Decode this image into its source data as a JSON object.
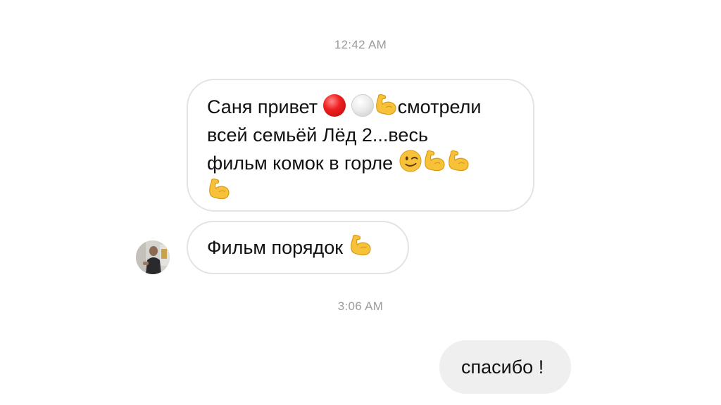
{
  "conversation": {
    "timestamps": [
      "12:42 AM",
      "3:06 AM"
    ],
    "messages": [
      {
        "direction": "incoming",
        "lines": [
          {
            "text_before": "Саня привет ",
            "text_after": "смотрели"
          },
          {
            "text": "всей семьёй Лёд 2...весь"
          },
          {
            "text": "фильм комок в горле "
          }
        ],
        "emoji_icons": [
          "red-circle-icon",
          "white-circle-icon",
          "flexed-biceps-icon",
          "winking-face-icon",
          "flexed-biceps-icon",
          "flexed-biceps-icon",
          "flexed-biceps-icon"
        ]
      },
      {
        "direction": "incoming",
        "text": "Фильм порядок ",
        "emoji_icons": [
          "flexed-biceps-icon"
        ]
      },
      {
        "direction": "outgoing",
        "text": "спасибо !"
      }
    ]
  },
  "colors": {
    "timestamp": "#9b9b9b",
    "incoming_border": "#e3e3e3",
    "outgoing_bg": "#efefef",
    "emoji_yellow": "#f7c23a"
  }
}
